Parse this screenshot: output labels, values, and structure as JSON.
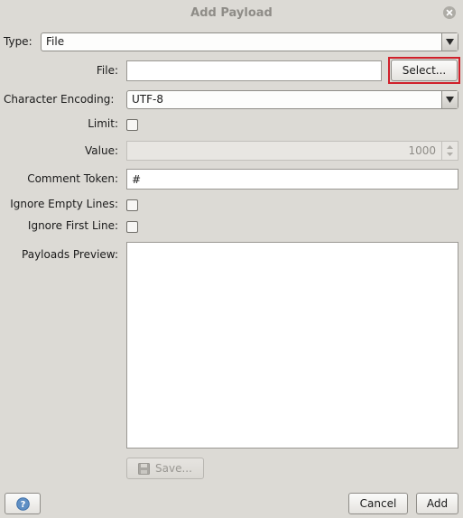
{
  "dialog": {
    "title": "Add Payload"
  },
  "type": {
    "label": "Type:",
    "value": "File"
  },
  "file": {
    "label": "File:",
    "value": "",
    "select_button": "Select..."
  },
  "encoding": {
    "label": "Character Encoding:",
    "value": "UTF-8"
  },
  "limit": {
    "label": "Limit:",
    "checked": false
  },
  "value_field": {
    "label": "Value:",
    "value": "1000"
  },
  "comment_token": {
    "label": "Comment Token:",
    "value": "#"
  },
  "ignore_empty_lines": {
    "label": "Ignore Empty Lines:",
    "checked": false
  },
  "ignore_first_line": {
    "label": "Ignore First Line:",
    "checked": false
  },
  "preview": {
    "label": "Payloads Preview:",
    "content": ""
  },
  "save_button": {
    "label": "Save..."
  },
  "footer": {
    "cancel": "Cancel",
    "add": "Add"
  },
  "icons": {
    "close": "close-icon",
    "save": "floppy-disk-icon",
    "help": "help-icon",
    "dropdown": "chevron-down-icon"
  },
  "colors": {
    "highlight": "#d0202a"
  }
}
